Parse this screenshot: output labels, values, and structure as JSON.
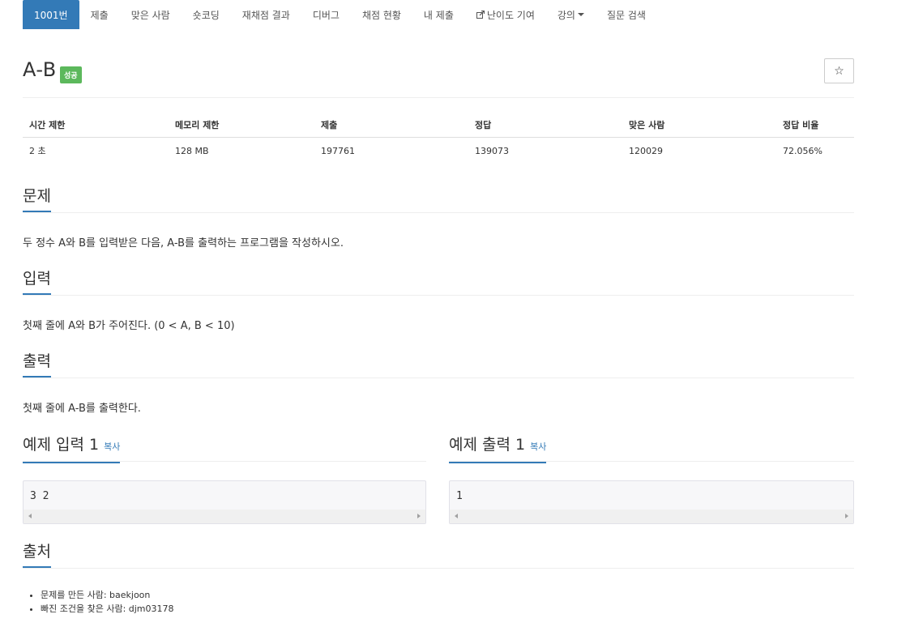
{
  "nav": {
    "items": [
      {
        "label": "1001번",
        "active": true
      },
      {
        "label": "제출"
      },
      {
        "label": "맞은 사람"
      },
      {
        "label": "숏코딩"
      },
      {
        "label": "재채점 결과"
      },
      {
        "label": "디버그"
      },
      {
        "label": "채점 현황"
      },
      {
        "label": "내 제출"
      },
      {
        "label": "난이도 기여",
        "icon": "external-link-icon"
      },
      {
        "label": "강의",
        "dropdown": true
      },
      {
        "label": "질문 검색"
      }
    ]
  },
  "problem": {
    "title": "A-B",
    "status_badge": "성공",
    "star_icon": "☆"
  },
  "info_table": {
    "headers": [
      "시간 제한",
      "메모리 제한",
      "제출",
      "정답",
      "맞은 사람",
      "정답 비율"
    ],
    "row": [
      "2 초",
      "128 MB",
      "197761",
      "139073",
      "120029",
      "72.056%"
    ]
  },
  "sections": {
    "problem": {
      "title": "문제",
      "body": "두 정수 A와 B를 입력받은 다음, A-B를 출력하는 프로그램을 작성하시오."
    },
    "input": {
      "title": "입력",
      "body": "첫째 줄에 A와 B가 주어진다. (0 < A, B < 10)"
    },
    "output": {
      "title": "출력",
      "body": "첫째 줄에 A-B를 출력한다."
    },
    "sample_input": {
      "title": "예제 입력 1",
      "copy_label": "복사",
      "content": "3 2"
    },
    "sample_output": {
      "title": "예제 출력 1",
      "copy_label": "복사",
      "content": "1"
    },
    "source": {
      "title": "출처",
      "items": [
        "문제를 만든 사람: baekjoon",
        "빠진 조건을 찾은 사람: djm03178"
      ]
    }
  },
  "colors": {
    "primary": "#337ab7",
    "success": "#5cb85c"
  }
}
